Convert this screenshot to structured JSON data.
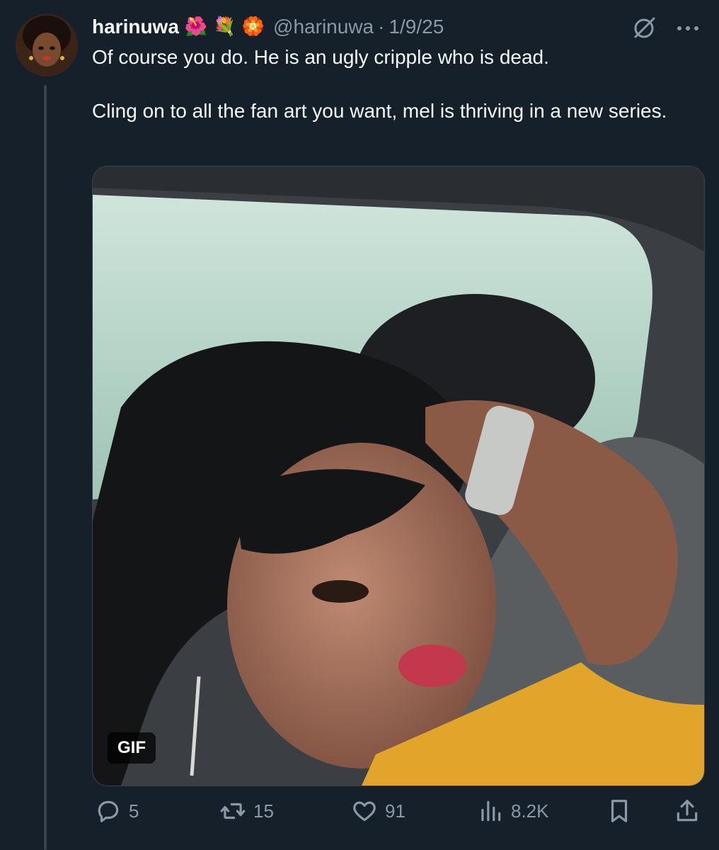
{
  "post": {
    "display_name": "harinuwa",
    "name_emojis": [
      "🌺",
      "💐",
      "🏵️"
    ],
    "handle": "@harinuwa",
    "separator": "·",
    "date": "1/9/25",
    "text_lines": [
      "Of course you do. He is an ugly cripple who is dead.",
      "Cling on to all the fan art you want, mel is thriving in a new series."
    ],
    "media_badge": "GIF"
  },
  "actions": {
    "replies": "5",
    "reposts": "15",
    "likes": "91",
    "views": "8.2K"
  },
  "icons": {
    "reply": "reply-icon",
    "repost": "repost-icon",
    "like": "heart-icon",
    "views": "views-icon",
    "bookmark": "bookmark-icon",
    "share": "share-icon",
    "grok": "grok-icon",
    "more": "more-icon"
  },
  "colors": {
    "background": "#15202b",
    "text": "#f7f9f9",
    "secondary": "#8b98a5"
  }
}
